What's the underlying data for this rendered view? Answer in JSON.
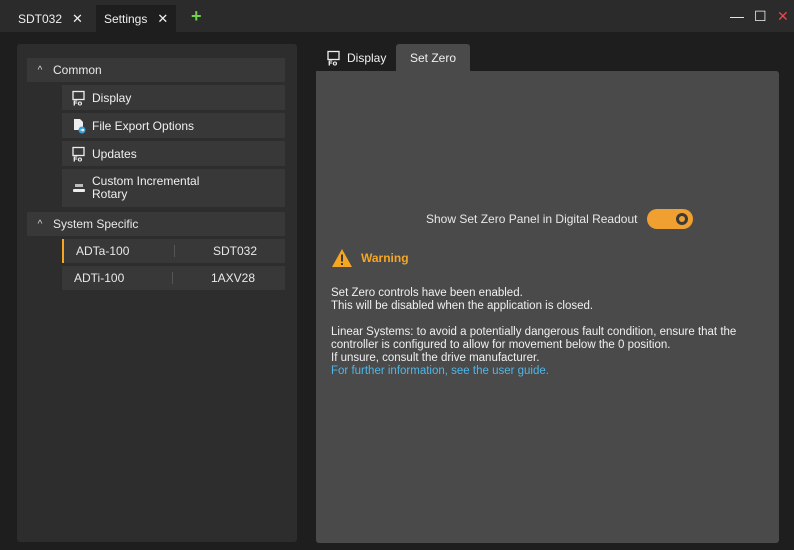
{
  "titlebar": {
    "tabs": [
      {
        "label": "SDT032",
        "close": "✕"
      },
      {
        "label": "Settings",
        "close": "✕"
      }
    ],
    "add": "+",
    "minimize": "—",
    "maximize": "☐",
    "close": "✕"
  },
  "sidebar": {
    "common": {
      "label": "Common",
      "chevron": "^",
      "items": [
        {
          "label": "Display",
          "icon": "display-settings-icon"
        },
        {
          "label": "File Export Options",
          "icon": "file-export-icon"
        },
        {
          "label": "Updates",
          "icon": "updates-settings-icon"
        },
        {
          "label_line1": "Custom Incremental",
          "label_line2": "Rotary",
          "icon": "rotary-icon"
        }
      ]
    },
    "system": {
      "label": "System Specific",
      "chevron": "^",
      "rows": [
        {
          "name": "ADTa-100",
          "serial": "SDT032",
          "selected": true
        },
        {
          "name": "ADTi-100",
          "serial": "1AXV28",
          "selected": false
        }
      ]
    }
  },
  "main": {
    "tabs": [
      {
        "label": "Display"
      },
      {
        "label": "Set Zero"
      }
    ],
    "toggle": {
      "label": "Show Set Zero Panel in Digital Readout",
      "on": true
    },
    "warning": {
      "title": "Warning",
      "line1": "Set Zero controls have been enabled.",
      "line2": "This will be disabled when the application is closed.",
      "line3": "Linear Systems: to avoid a potentially dangerous fault condition, ensure that the",
      "line4": "controller is configured to allow for movement below the 0 position.",
      "line5": "If unsure, consult the drive manufacturer.",
      "link": "For further information, see the user guide."
    }
  },
  "colors": {
    "accent": "#f5a623",
    "link": "#4fb6e8",
    "add": "#6fd24a",
    "close": "#e5484d"
  }
}
